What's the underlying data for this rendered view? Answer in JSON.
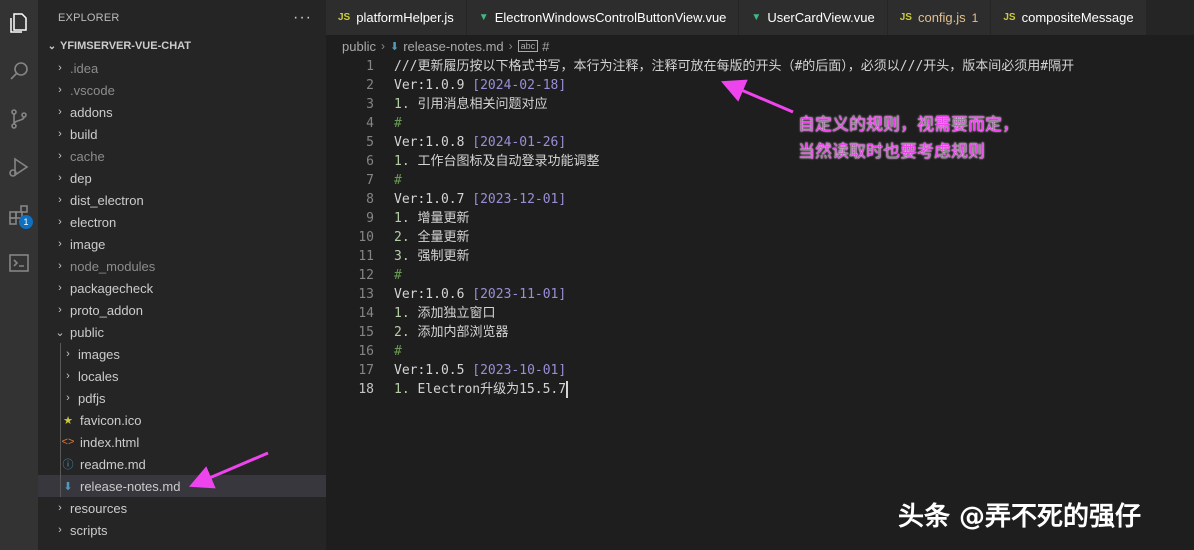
{
  "activity_bar": {
    "icons": [
      "explorer-icon",
      "search-icon",
      "source-control-icon",
      "run-debug-icon",
      "extensions-icon",
      "terminal-icon"
    ],
    "extensions_badge": "1"
  },
  "sidebar": {
    "title": "EXPLORER",
    "more": "···",
    "project": "YFIMSERVER-VUE-CHAT",
    "items": [
      {
        "label": ".idea",
        "type": "folder",
        "dim": true
      },
      {
        "label": ".vscode",
        "type": "folder",
        "dim": true
      },
      {
        "label": "addons",
        "type": "folder",
        "dim": false
      },
      {
        "label": "build",
        "type": "folder",
        "dim": false
      },
      {
        "label": "cache",
        "type": "folder",
        "dim": true
      },
      {
        "label": "dep",
        "type": "folder",
        "dim": false
      },
      {
        "label": "dist_electron",
        "type": "folder",
        "dim": false
      },
      {
        "label": "electron",
        "type": "folder",
        "dim": false
      },
      {
        "label": "image",
        "type": "folder",
        "dim": false
      },
      {
        "label": "node_modules",
        "type": "folder",
        "dim": true
      },
      {
        "label": "packagecheck",
        "type": "folder",
        "dim": false
      },
      {
        "label": "proto_addon",
        "type": "folder",
        "dim": false
      },
      {
        "label": "public",
        "type": "folder-open",
        "dim": false
      },
      {
        "label": "images",
        "type": "folder",
        "dim": false,
        "child": true
      },
      {
        "label": "locales",
        "type": "folder",
        "dim": false,
        "child": true
      },
      {
        "label": "pdfjs",
        "type": "folder",
        "dim": false,
        "child": true
      },
      {
        "label": "favicon.ico",
        "type": "file-star",
        "dim": false,
        "child": true
      },
      {
        "label": "index.html",
        "type": "file-html",
        "dim": false,
        "child": true
      },
      {
        "label": "readme.md",
        "type": "file-info",
        "dim": false,
        "child": true
      },
      {
        "label": "release-notes.md",
        "type": "file-md",
        "dim": false,
        "child": true,
        "selected": true
      },
      {
        "label": "resources",
        "type": "folder",
        "dim": false
      },
      {
        "label": "scripts",
        "type": "folder",
        "dim": false
      }
    ]
  },
  "tabs": [
    {
      "label": "platformHelper.js",
      "kind": "js"
    },
    {
      "label": "ElectronWindowsControlButtonView.vue",
      "kind": "vue"
    },
    {
      "label": "UserCardView.vue",
      "kind": "vue"
    },
    {
      "label": "config.js",
      "kind": "js",
      "modified": true,
      "count": "1"
    },
    {
      "label": "compositeMessage",
      "kind": "js"
    }
  ],
  "breadcrumb": {
    "folder": "public",
    "file": "release-notes.md",
    "symbol_badge": "abc",
    "symbol": "#"
  },
  "editor": {
    "active_line": 18,
    "lines": [
      {
        "n": "1",
        "parts": [
          [
            "t",
            "///更新履历按以下格式书写，本行为注释，注释可放在每版的开头（#的后面），必须以///开头，版本间必须用#隔开"
          ]
        ]
      },
      {
        "n": "2",
        "parts": [
          [
            "t",
            "Ver:1.0.9 "
          ],
          [
            "br",
            "["
          ],
          [
            "date",
            "2024-02-18"
          ],
          [
            "br",
            "]"
          ]
        ]
      },
      {
        "n": "3",
        "parts": [
          [
            "num",
            "1."
          ],
          [
            "t",
            " 引用消息相关问题对应"
          ]
        ]
      },
      {
        "n": "4",
        "parts": [
          [
            "hash",
            "#"
          ]
        ]
      },
      {
        "n": "5",
        "parts": [
          [
            "t",
            "Ver:1.0.8 "
          ],
          [
            "br",
            "["
          ],
          [
            "date",
            "2024-01-26"
          ],
          [
            "br",
            "]"
          ]
        ]
      },
      {
        "n": "6",
        "parts": [
          [
            "num",
            "1."
          ],
          [
            "t",
            " 工作台图标及自动登录功能调整"
          ]
        ]
      },
      {
        "n": "7",
        "parts": [
          [
            "hash",
            "#"
          ]
        ]
      },
      {
        "n": "8",
        "parts": [
          [
            "t",
            "Ver:1.0.7 "
          ],
          [
            "br",
            "["
          ],
          [
            "date",
            "2023-12-01"
          ],
          [
            "br",
            "]"
          ]
        ]
      },
      {
        "n": "9",
        "parts": [
          [
            "num",
            "1."
          ],
          [
            "t",
            " 增量更新"
          ]
        ]
      },
      {
        "n": "10",
        "parts": [
          [
            "num",
            "2."
          ],
          [
            "t",
            " 全量更新"
          ]
        ]
      },
      {
        "n": "11",
        "parts": [
          [
            "num",
            "3."
          ],
          [
            "t",
            " 强制更新"
          ]
        ]
      },
      {
        "n": "12",
        "parts": [
          [
            "hash",
            "#"
          ]
        ]
      },
      {
        "n": "13",
        "parts": [
          [
            "t",
            "Ver:1.0.6 "
          ],
          [
            "br",
            "["
          ],
          [
            "date",
            "2023-11-01"
          ],
          [
            "br",
            "]"
          ]
        ]
      },
      {
        "n": "14",
        "parts": [
          [
            "num",
            "1."
          ],
          [
            "t",
            " 添加独立窗口"
          ]
        ]
      },
      {
        "n": "15",
        "parts": [
          [
            "num",
            "2."
          ],
          [
            "t",
            " 添加内部浏览器"
          ]
        ]
      },
      {
        "n": "16",
        "parts": [
          [
            "hash",
            "#"
          ]
        ]
      },
      {
        "n": "17",
        "parts": [
          [
            "t",
            "Ver:1.0.5 "
          ],
          [
            "br",
            "["
          ],
          [
            "date",
            "2023-10-01"
          ],
          [
            "br",
            "]"
          ]
        ]
      },
      {
        "n": "18",
        "parts": [
          [
            "num",
            "1."
          ],
          [
            "t",
            " Electron升级为15.5.7"
          ]
        ]
      }
    ]
  },
  "annotation": {
    "line1": "自定义的规则，视需要而定，",
    "line2": "当然读取时也要考虑规则",
    "color": "#ee44ee"
  },
  "watermark": "头条 @弄不死的强仔"
}
